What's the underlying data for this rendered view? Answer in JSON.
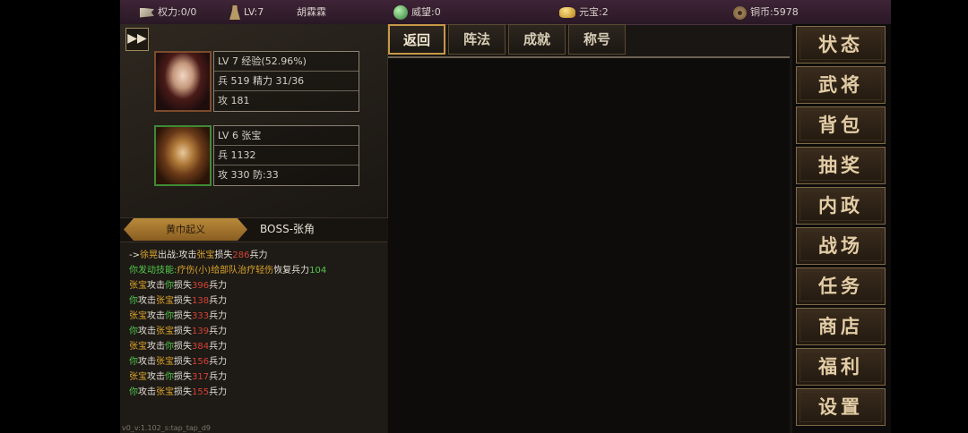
{
  "topbar": {
    "power": "权力:0/0",
    "level": "LV:7",
    "player_name": "胡霖霖",
    "prestige": "威望:0",
    "yuanbao": "元宝:2",
    "copper": "铜币:5978",
    "icons": [
      "flag-icon",
      "person-icon",
      "jade-orb-icon",
      "gold-ingot-icon",
      "copper-coin-icon"
    ]
  },
  "fast_forward": "▶▶",
  "heroes": [
    {
      "line1": "LV 7 经验(52.96%)",
      "line2": "兵 519 精力 31/36",
      "line3": "攻 181"
    },
    {
      "line1": "LV 6  张宝",
      "line2": "兵 1132",
      "line3": "攻 330 防:33"
    }
  ],
  "stage": {
    "name": "黄巾起义",
    "boss": "BOSS-张角"
  },
  "battle_log": [
    [
      {
        "t": "->",
        "c": "w"
      },
      {
        "t": "徐晃",
        "c": "o"
      },
      {
        "t": "出战:攻击",
        "c": "w"
      },
      {
        "t": "张宝",
        "c": "o"
      },
      {
        "t": "损失",
        "c": "w"
      },
      {
        "t": "286",
        "c": "r"
      },
      {
        "t": "兵力",
        "c": "w"
      }
    ],
    [
      {
        "t": "你发动技能:",
        "c": "g"
      },
      {
        "t": "疗伤(小)",
        "c": "o"
      },
      {
        "t": "给部队治疗轻伤",
        "c": "o"
      },
      {
        "t": "恢复兵力",
        "c": "w"
      },
      {
        "t": "104",
        "c": "g"
      }
    ],
    [
      {
        "t": "张宝",
        "c": "o"
      },
      {
        "t": "攻击",
        "c": "w"
      },
      {
        "t": "你",
        "c": "g"
      },
      {
        "t": "损失",
        "c": "w"
      },
      {
        "t": "396",
        "c": "r"
      },
      {
        "t": "兵力",
        "c": "w"
      }
    ],
    [
      {
        "t": "你",
        "c": "g"
      },
      {
        "t": "攻击",
        "c": "w"
      },
      {
        "t": "张宝",
        "c": "o"
      },
      {
        "t": "损失",
        "c": "w"
      },
      {
        "t": "138",
        "c": "r"
      },
      {
        "t": "兵力",
        "c": "w"
      }
    ],
    [
      {
        "t": "张宝",
        "c": "o"
      },
      {
        "t": "攻击",
        "c": "w"
      },
      {
        "t": "你",
        "c": "g"
      },
      {
        "t": "损失",
        "c": "w"
      },
      {
        "t": "333",
        "c": "r"
      },
      {
        "t": "兵力",
        "c": "w"
      }
    ],
    [
      {
        "t": "你",
        "c": "g"
      },
      {
        "t": "攻击",
        "c": "w"
      },
      {
        "t": "张宝",
        "c": "o"
      },
      {
        "t": "损失",
        "c": "w"
      },
      {
        "t": "139",
        "c": "r"
      },
      {
        "t": "兵力",
        "c": "w"
      }
    ],
    [
      {
        "t": "张宝",
        "c": "o"
      },
      {
        "t": "攻击",
        "c": "w"
      },
      {
        "t": "你",
        "c": "g"
      },
      {
        "t": "损失",
        "c": "w"
      },
      {
        "t": "384",
        "c": "r"
      },
      {
        "t": "兵力",
        "c": "w"
      }
    ],
    [
      {
        "t": "你",
        "c": "g"
      },
      {
        "t": "攻击",
        "c": "w"
      },
      {
        "t": "张宝",
        "c": "o"
      },
      {
        "t": "损失",
        "c": "w"
      },
      {
        "t": "156",
        "c": "r"
      },
      {
        "t": "兵力",
        "c": "w"
      }
    ],
    [
      {
        "t": "张宝",
        "c": "o"
      },
      {
        "t": "攻击",
        "c": "w"
      },
      {
        "t": "你",
        "c": "g"
      },
      {
        "t": "损失",
        "c": "w"
      },
      {
        "t": "317",
        "c": "r"
      },
      {
        "t": "兵力",
        "c": "w"
      }
    ],
    [
      {
        "t": "你",
        "c": "g"
      },
      {
        "t": "攻击",
        "c": "w"
      },
      {
        "t": "张宝",
        "c": "o"
      },
      {
        "t": "损失",
        "c": "w"
      },
      {
        "t": "155",
        "c": "r"
      },
      {
        "t": "兵力",
        "c": "w"
      }
    ]
  ],
  "version": "v0_v:1.102_s:tap_tap_d9",
  "tabs": [
    "返回",
    "阵法",
    "成就",
    "称号"
  ],
  "menu": [
    "状态",
    "武将",
    "背包",
    "抽奖",
    "内政",
    "战场",
    "任务",
    "商店",
    "福利",
    "设置"
  ],
  "colors": {
    "log_white": "#e2ddd4",
    "log_green": "#52c84a",
    "log_orange": "#d9a42a",
    "log_red": "#d44236",
    "accent_gold": "#c89848"
  }
}
